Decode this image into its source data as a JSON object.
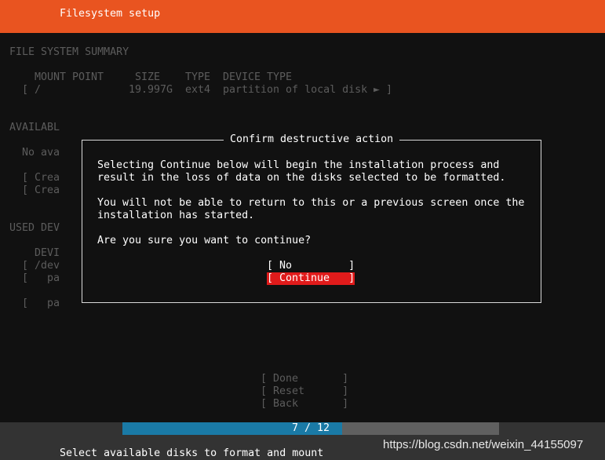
{
  "header": {
    "title": "Filesystem setup"
  },
  "summary": {
    "heading": "FILE SYSTEM SUMMARY",
    "columns": [
      "MOUNT POINT",
      "SIZE",
      "TYPE",
      "DEVICE TYPE"
    ],
    "row": {
      "bracket_open": "[",
      "mount": "/",
      "size": "19.997G",
      "type": "ext4",
      "device_type": "partition of local disk",
      "arrow": "►",
      "bracket_close": "]"
    }
  },
  "background": {
    "available_heading": "AVAILABL",
    "no_available": "No ava",
    "create_1": "[ Crea",
    "create_2": "[ Crea",
    "used_heading": "USED DEV",
    "device_col": "DEVI",
    "dev_row": "[ /dev",
    "part_row_1": "[   pa",
    "part_row_2": "[   pa"
  },
  "dialog": {
    "title": "Confirm destructive action",
    "line1": "Selecting Continue below will begin the installation process and",
    "line2": "result in the loss of data on the disks selected to be formatted.",
    "line3": "You will not be able to return to this or a previous screen once the",
    "line4": "installation has started.",
    "question": "Are you sure you want to continue?",
    "no_label": "[ No         ]",
    "continue_label": "[ Continue   ]"
  },
  "actions": {
    "done": "[ Done       ]",
    "reset": "[ Reset      ]",
    "back": "[ Back       ]"
  },
  "progress": {
    "label": "7 / 12",
    "current": 7,
    "total": 12
  },
  "footer": {
    "hint": "Select available disks to format and mount"
  },
  "watermark": "https://blog.csdn.net/weixin_44155097",
  "colors": {
    "accent": "#e95420",
    "selected": "#e01b1b",
    "progress": "#1a7aa6"
  }
}
